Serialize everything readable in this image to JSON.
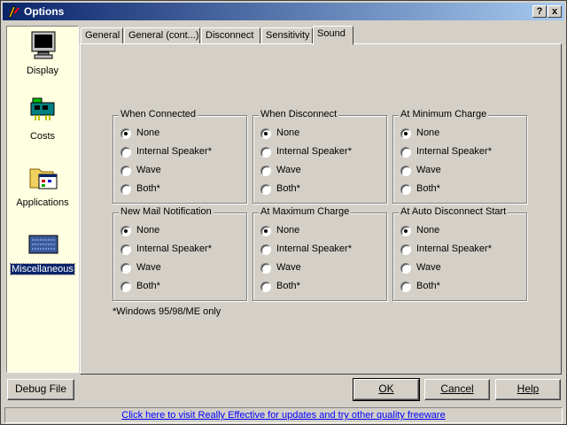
{
  "window": {
    "title": "Options"
  },
  "titlebar": {
    "help_glyph": "?",
    "close_glyph": "x"
  },
  "sidebar": {
    "items": [
      {
        "label": "Display",
        "icon": "monitor-icon"
      },
      {
        "label": "Costs",
        "icon": "circuit-board-icon"
      },
      {
        "label": "Applications",
        "icon": "folder-applications-icon"
      },
      {
        "label": "Miscellaneous",
        "icon": "keyboard-icon",
        "selected": true
      }
    ]
  },
  "tabs": [
    "General",
    "General (cont...)",
    "Disconnect",
    "Sensitivity",
    "Sound"
  ],
  "active_tab": "Sound",
  "groups": [
    {
      "title": "When Connected",
      "options": [
        "None",
        "Internal Speaker*",
        "Wave",
        "Both*"
      ],
      "selected": "None"
    },
    {
      "title": "When Disconnect",
      "options": [
        "None",
        "Internal Speaker*",
        "Wave",
        "Both*"
      ],
      "selected": "None"
    },
    {
      "title": "At Minimum Charge",
      "options": [
        "None",
        "Internal Speaker*",
        "Wave",
        "Both*"
      ],
      "selected": "None"
    },
    {
      "title": "New Mail Notification",
      "options": [
        "None",
        "Internal Speaker*",
        "Wave",
        "Both*"
      ],
      "selected": "None"
    },
    {
      "title": "At Maximum Charge",
      "options": [
        "None",
        "Internal Speaker*",
        "Wave",
        "Both*"
      ],
      "selected": "None"
    },
    {
      "title": "At Auto Disconnect Start",
      "options": [
        "None",
        "Internal Speaker*",
        "Wave",
        "Both*"
      ],
      "selected": "None"
    }
  ],
  "note": "*Windows 95/98/ME only",
  "buttons": {
    "debug": "Debug File",
    "ok": "OK",
    "cancel": "Cancel",
    "help": "Help"
  },
  "status": {
    "link": "Click here to visit Really Effective for updates and try other quality freeware"
  },
  "colors": {
    "title_start": "#0a246a",
    "title_end": "#a6caf0",
    "sidebar_bg": "#ffffe1",
    "face": "#d4d0c8",
    "link": "#0000ff"
  }
}
